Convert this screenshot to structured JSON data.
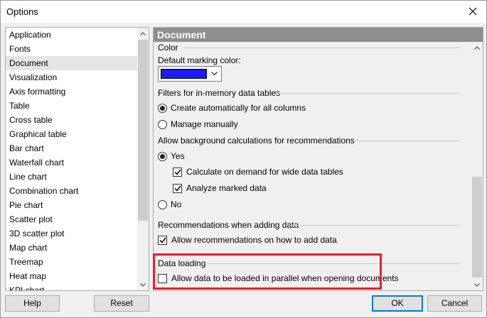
{
  "window": {
    "title": "Options"
  },
  "left_list": {
    "items": [
      {
        "label": "Application"
      },
      {
        "label": "Fonts"
      },
      {
        "label": "Document",
        "selected": true
      },
      {
        "label": "Visualization"
      },
      {
        "label": "Axis formatting"
      },
      {
        "label": "Table"
      },
      {
        "label": "Cross table"
      },
      {
        "label": "Graphical table"
      },
      {
        "label": "Bar chart"
      },
      {
        "label": "Waterfall chart"
      },
      {
        "label": "Line chart"
      },
      {
        "label": "Combination chart"
      },
      {
        "label": "Pie chart"
      },
      {
        "label": "Scatter plot"
      },
      {
        "label": "3D scatter plot"
      },
      {
        "label": "Map chart"
      },
      {
        "label": "Treemap"
      },
      {
        "label": "Heat map"
      },
      {
        "label": "KPI chart"
      }
    ]
  },
  "panel": {
    "header": "Document",
    "color_section": "Color",
    "default_marking_label": "Default marking color:",
    "marking_color": "#1b1bff",
    "filters_section": "Filters for in-memory data tables",
    "filters_auto": "Create automatically for all columns",
    "filters_manual": "Manage manually",
    "filters_selected": "auto",
    "bg_section": "Allow background calculations for recommendations",
    "bg_yes": "Yes",
    "bg_no": "No",
    "bg_selected": "yes",
    "calc_on_demand": "Calculate on demand for wide data tables",
    "calc_on_demand_checked": true,
    "analyze_marked": "Analyze marked data",
    "analyze_marked_checked": true,
    "rec_section": "Recommendations when adding data",
    "allow_recs": "Allow recommendations on how to add data",
    "allow_recs_checked": true,
    "loading_section": "Data loading",
    "parallel_load": "Allow data to be loaded in parallel when opening documents",
    "parallel_load_checked": false
  },
  "buttons": {
    "help": "Help",
    "reset": "Reset",
    "ok": "OK",
    "cancel": "Cancel"
  },
  "colors": {
    "highlight": "#e8202a",
    "panel_header": "#8f8f8f"
  }
}
